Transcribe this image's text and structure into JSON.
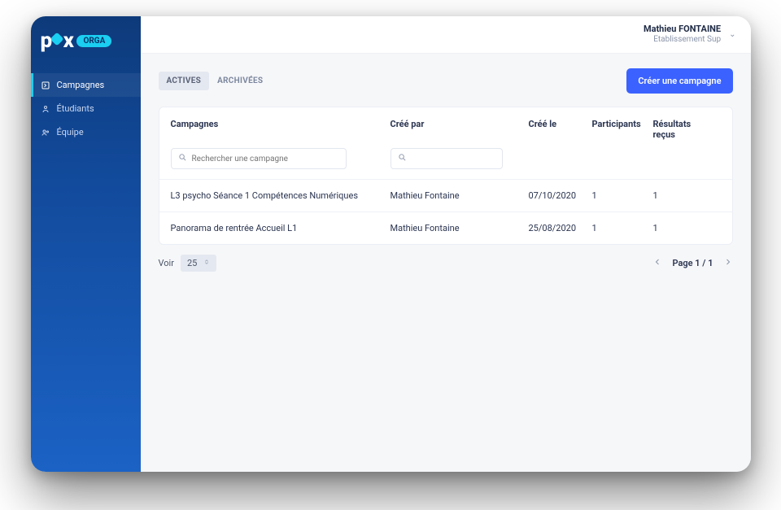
{
  "brand": {
    "pix": "pix",
    "orga": "ORGA"
  },
  "sidebar": {
    "items": [
      {
        "label": "Campagnes"
      },
      {
        "label": "Étudiants"
      },
      {
        "label": "Équipe"
      }
    ]
  },
  "header": {
    "user_name": "Mathieu FONTAINE",
    "org": "Etablissement Sup"
  },
  "tabs": {
    "active": "ACTIVES",
    "archived": "ARCHIVÉES"
  },
  "actions": {
    "create_campaign": "Créer une campagne"
  },
  "table": {
    "columns": {
      "campaign": "Campagnes",
      "author": "Créé par",
      "created": "Créé le",
      "participants": "Participants",
      "results": "Résultats reçus"
    },
    "search_placeholder": "Rechercher une campagne",
    "rows": [
      {
        "campaign": "L3 psycho Séance 1 Compétences Numériques",
        "author": "Mathieu Fontaine",
        "created": "07/10/2020",
        "participants": "1",
        "results": "1"
      },
      {
        "campaign": "Panorama de rentrée Accueil L1",
        "author": "Mathieu Fontaine",
        "created": "25/08/2020",
        "participants": "1",
        "results": "1"
      }
    ]
  },
  "pager": {
    "see_label": "Voir",
    "page_size": "25",
    "page_label": "Page 1 / 1"
  }
}
